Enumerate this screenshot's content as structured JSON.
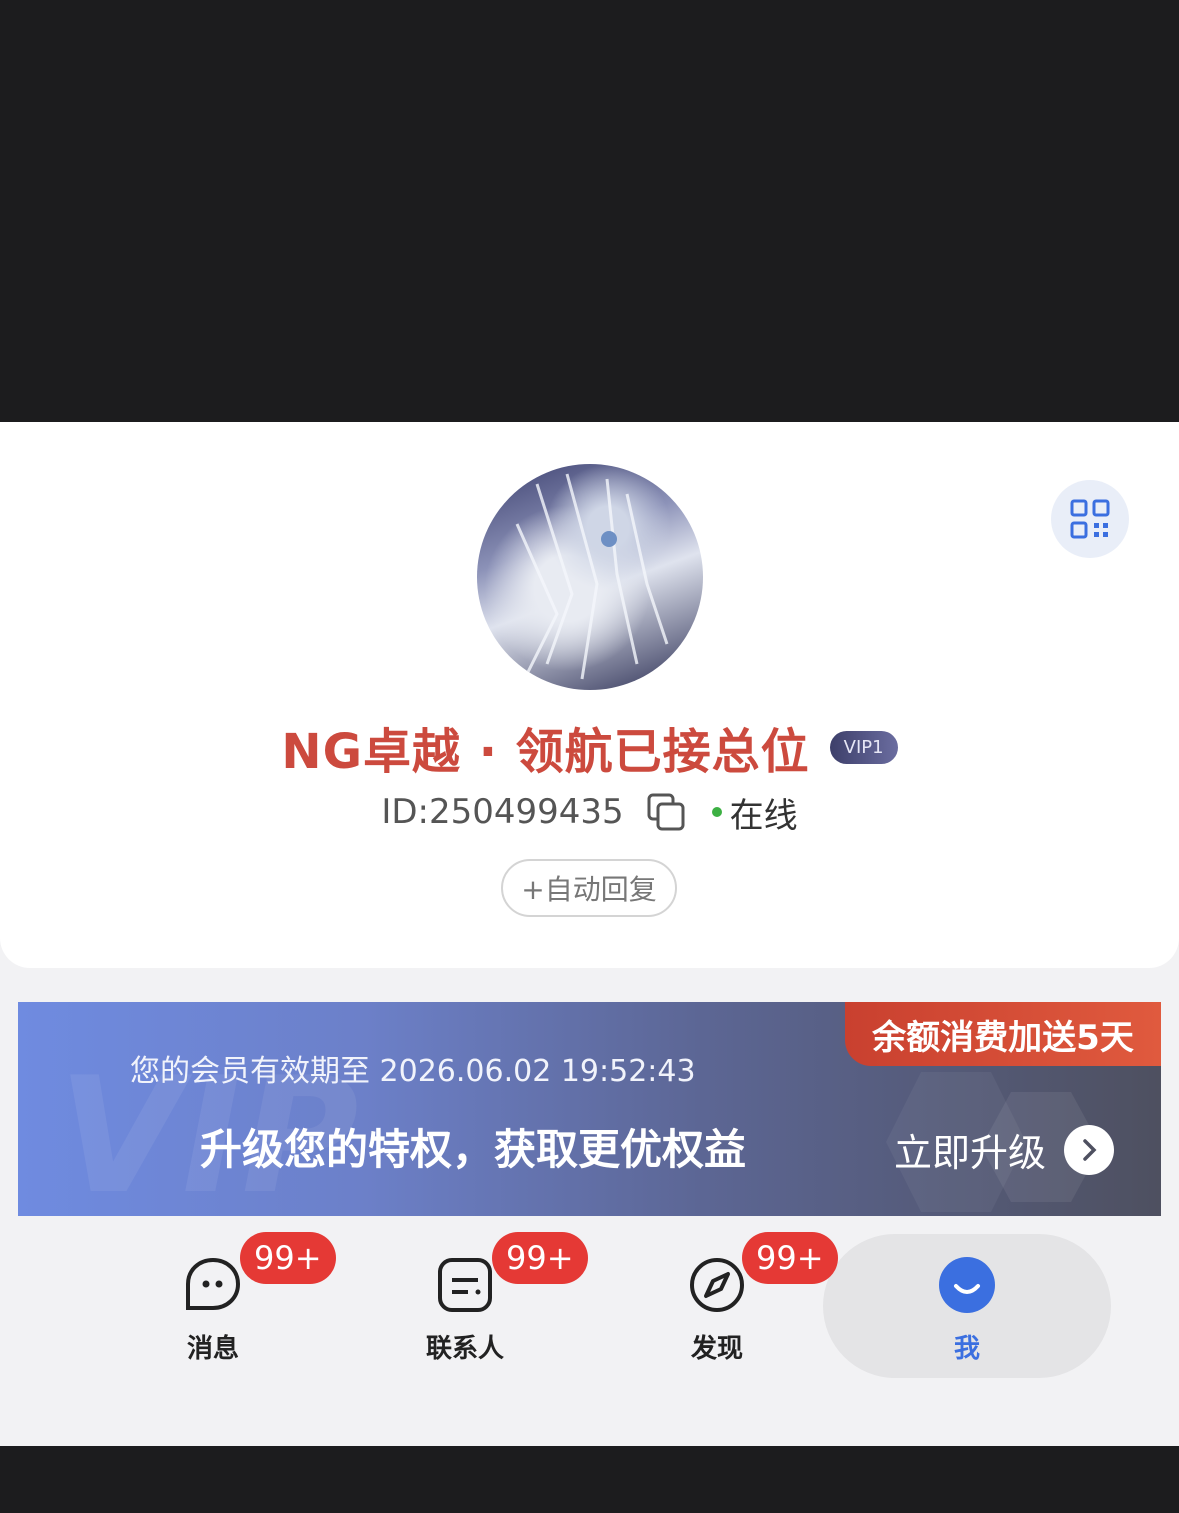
{
  "profile": {
    "nickname": "NG卓越 · 领航已接总位",
    "vip_level": "VIP1",
    "user_id": "ID:250499435",
    "status": "在线",
    "auto_reply_label": "+自动回复"
  },
  "vip_banner": {
    "promo_tag": "余额消费加送5天",
    "expiry_text": "您的会员有效期至  2026.06.02 19:52:43",
    "slogan": "升级您的特权，获取更优权益",
    "upgrade_label": "立即升级",
    "watermark": "VIP"
  },
  "tabs": [
    {
      "label": "消息",
      "badge": "99+",
      "icon": "chat-bubble-icon"
    },
    {
      "label": "联系人",
      "badge": "99+",
      "icon": "contacts-icon"
    },
    {
      "label": "发现",
      "badge": "99+",
      "icon": "compass-icon"
    },
    {
      "label": "我",
      "badge": "",
      "icon": "smile-icon",
      "active": true
    }
  ],
  "colors": {
    "nickname": "#cc4a3e",
    "accent_blue": "#3b6fe0",
    "badge_red": "#e53935",
    "online_green": "#3cb043"
  }
}
